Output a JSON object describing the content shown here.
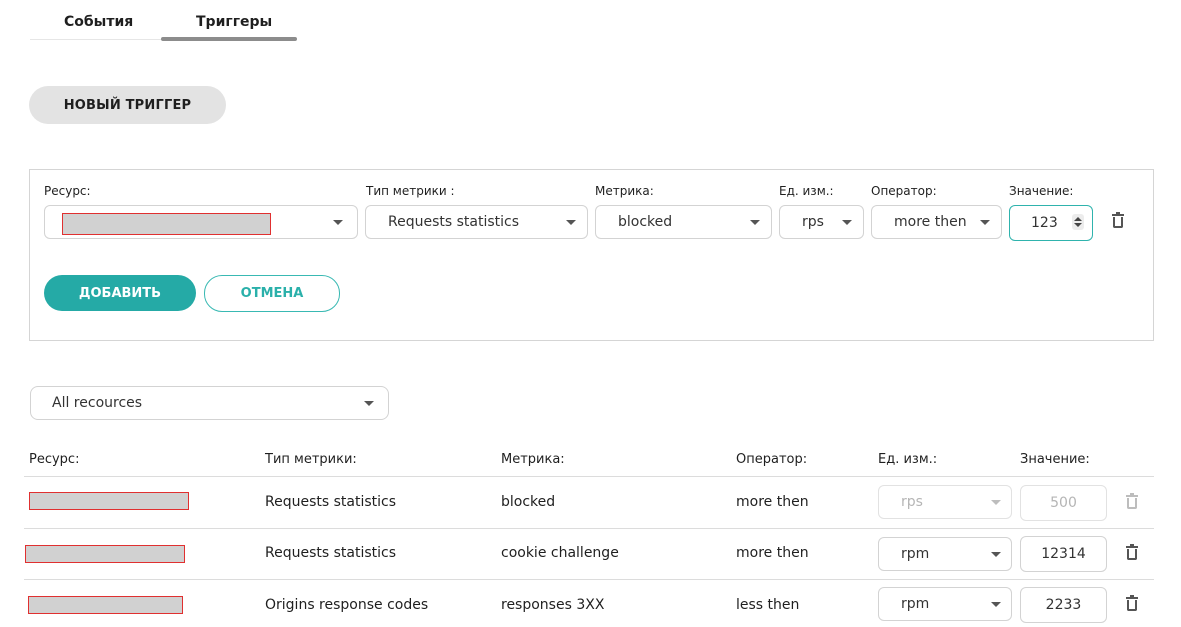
{
  "tabs": [
    {
      "label": "События",
      "active": false
    },
    {
      "label": "Триггеры",
      "active": true
    }
  ],
  "new_trigger_label": "НОВЫЙ ТРИГГЕР",
  "form": {
    "labels": {
      "resource": "Ресурс:",
      "metric_type": "Тип метрики :",
      "metric": "Метрика:",
      "unit": "Ед. изм.:",
      "operator": "Оператор:",
      "value": "Значение:"
    },
    "values": {
      "metric_type": "Requests statistics",
      "metric": "blocked",
      "unit": "rps",
      "operator": "more then",
      "value": "123"
    },
    "add_label": "ДОБАВИТЬ",
    "cancel_label": "ОТМЕНА"
  },
  "filter": {
    "selected": "All recources"
  },
  "table": {
    "headers": {
      "resource": "Ресурс:",
      "metric_type": "Тип метрики:",
      "metric": "Метрика:",
      "operator": "Оператор:",
      "unit": "Ед. изм.:",
      "value": "Значение:"
    },
    "rows": [
      {
        "metric_type": "Requests statistics",
        "metric": "blocked",
        "operator": "more then",
        "unit": "rps",
        "value": "500",
        "disabled": true
      },
      {
        "metric_type": "Requests statistics",
        "metric": "cookie challenge",
        "operator": "more then",
        "unit": "rpm",
        "value": "12314",
        "disabled": false
      },
      {
        "metric_type": "Origins response codes",
        "metric": "responses 3XX",
        "operator": "less then",
        "unit": "rpm",
        "value": "2233",
        "disabled": false
      }
    ]
  },
  "colors": {
    "accent": "#25aaa6",
    "redaction_border": "#e03030",
    "redaction_fill": "#d1d1d1"
  },
  "icons": [
    "chevron-down-icon",
    "trash-icon",
    "spinner-icon"
  ]
}
